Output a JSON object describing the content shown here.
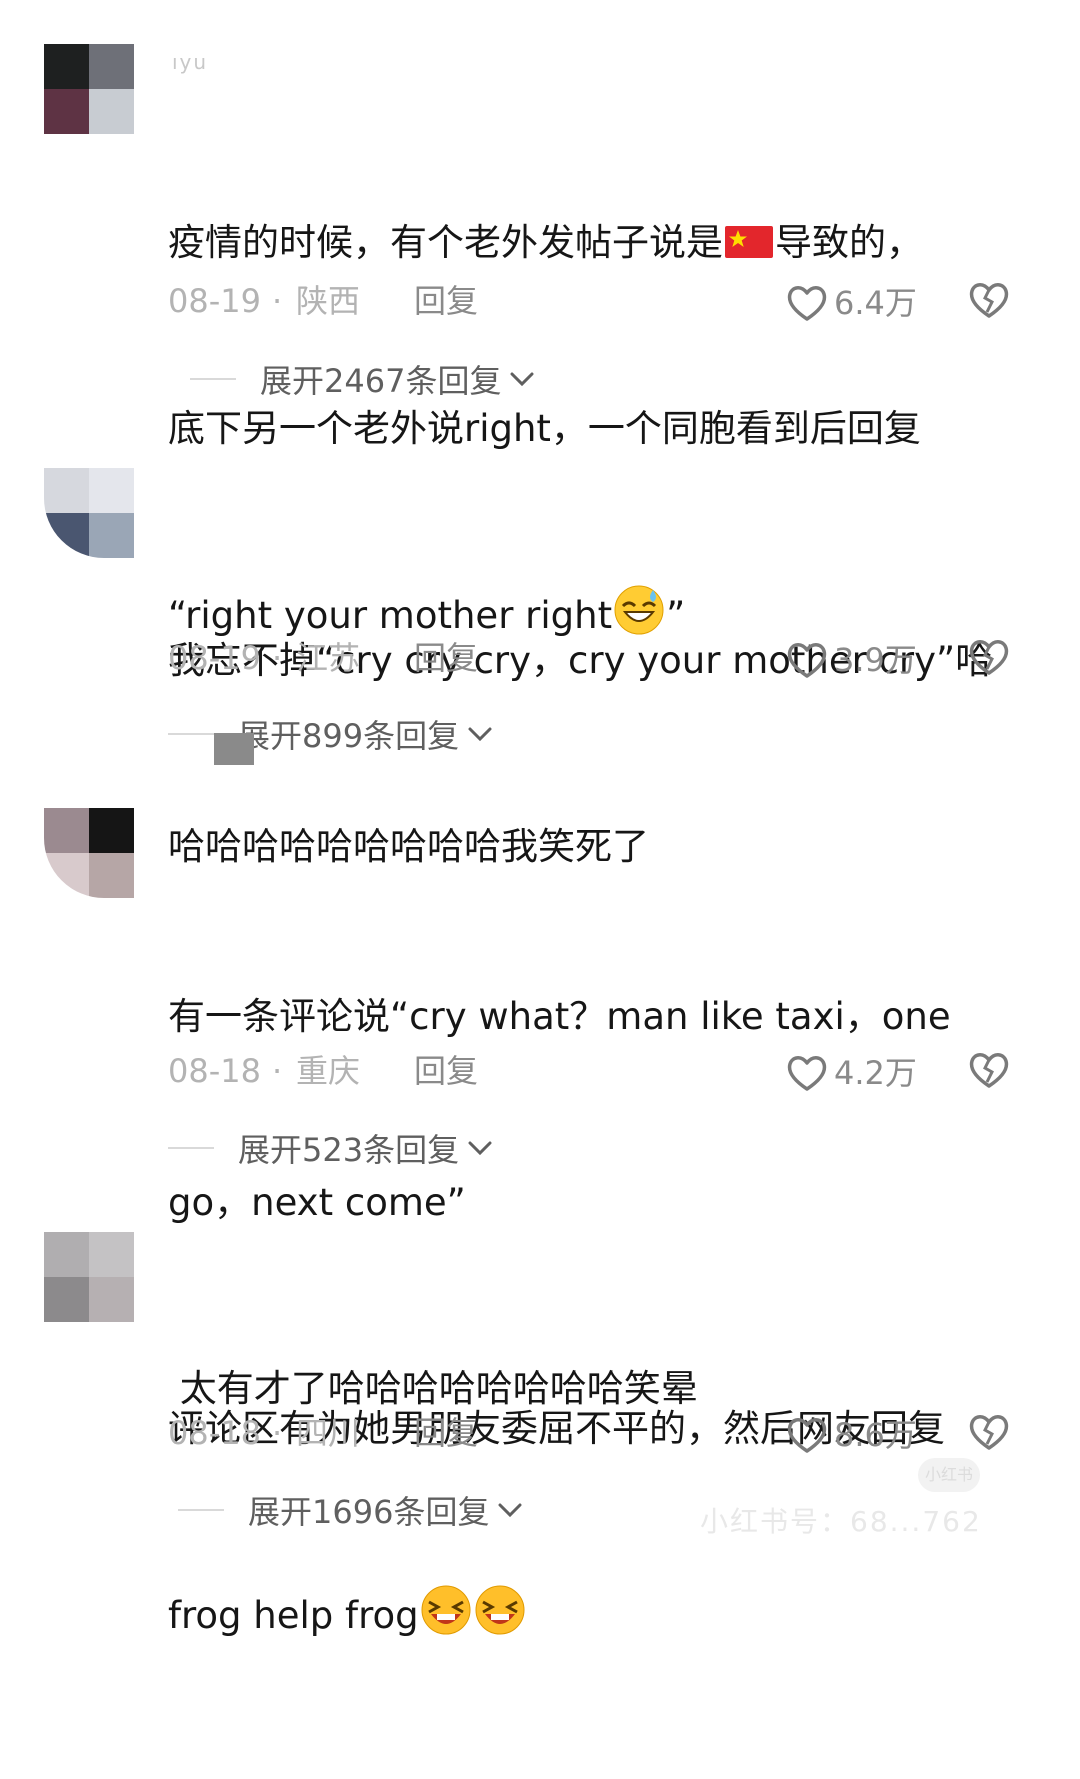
{
  "comments": [
    {
      "username": "ıyu",
      "avatar_colors": [
        "#1e2020",
        "#6e7078",
        "#5e3344",
        "#c8ccd2"
      ],
      "lines": [
        {
          "before": "疫情的时候，有个老外发帖子说是",
          "after": "导致的，",
          "inline": "flag"
        },
        {
          "before": "底下另一个老外说right，一个同胞看到后回复"
        },
        {
          "before": "“right your mother right",
          "after": "”",
          "inline": "emoji-sweat"
        }
      ],
      "date": "08-19",
      "region": "陕西",
      "reply_label": "回复",
      "likes": "6.4万",
      "expand_label": "展开2467条回复"
    },
    {
      "username": "",
      "avatar_colors": [
        "#d6d8de",
        "#e4e6ec",
        "#4a5670",
        "#9aa6b6"
      ],
      "lines": [
        {
          "before": "我忘不掉“cry cry cry，cry your mother cry”哈"
        },
        {
          "before": "哈哈哈哈哈哈哈哈哈我笑死了"
        }
      ],
      "date": "08-19",
      "region": "江苏",
      "reply_label": "回复",
      "likes": "3.9万",
      "expand_label": "展开899条回复"
    },
    {
      "username": "",
      "avatar_colors": [
        "#9b8a90",
        "#151515",
        "#d8cacc",
        "#b6a6a6"
      ],
      "lines": [
        {
          "before": "有一条评论说“cry what？man like taxi，one"
        },
        {
          "before": "go，next come”"
        },
        {
          "before": " 太有才了哈哈哈哈哈哈哈哈笑晕"
        }
      ],
      "date": "08-18",
      "region": "重庆",
      "reply_label": "回复",
      "likes": "4.2万",
      "expand_label": "展开523条回复"
    },
    {
      "username": "",
      "avatar_colors": [
        "#b0aeb0",
        "#c4c2c4",
        "#8c8a8c",
        "#b6b0b2"
      ],
      "lines": [
        {
          "before": "评论区有为她男朋友委屈不平的，然后网友回复"
        },
        {
          "before": "frog help frog",
          "inline": "emoji-laugh2"
        }
      ],
      "date": "08-18",
      "region": "四川",
      "reply_label": "回复",
      "likes": "8.6万",
      "expand_label": "展开1696条回复"
    }
  ],
  "separator_dot": "·",
  "watermark": {
    "logo_text": "小红书",
    "text": "小红书号：68...762"
  }
}
